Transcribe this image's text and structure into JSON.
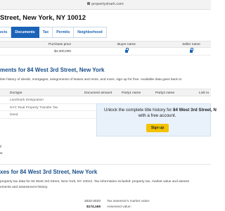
{
  "browser": {
    "url": "propertyshark.com"
  },
  "address": "Street, New York, NY 10012",
  "tabs": [
    {
      "label": "ects"
    },
    {
      "label": "Documents"
    },
    {
      "label": "Tax"
    },
    {
      "label": "Permits"
    },
    {
      "label": "Neighborhood"
    }
  ],
  "sale_table": {
    "headers": {
      "price": "Purchase price",
      "buyer": "Buyer name",
      "seller": "Seller name"
    },
    "row": {
      "price": "$4,300,000"
    }
  },
  "documents": {
    "heading": "ments for 84 West 3rd Street, New York",
    "description": "lete history of deeds, mortgages, assignments of leases and rents, and more, sign up for free. Available data goes back to",
    "columns": {
      "type": "Doctype",
      "amount": "Document amount",
      "party1": "Party1 name",
      "party2": "Party2 name",
      "link": "Link to"
    },
    "rows": [
      {
        "doctype": "Landmark Designation"
      },
      {
        "doctype": "NYC Real Property Transfer Tax"
      },
      {
        "doctype": "Deed"
      }
    ]
  },
  "unlock": {
    "text_prefix": "Unlock the complete title history for ",
    "text_bold": "84 West 3rd Street, N",
    "text_line2": "with a free account.",
    "button": "Sign up"
  },
  "fragments": {
    "a": "y",
    "b": "w"
  },
  "taxes": {
    "heading": "xes for 84 West 3rd Street, New York",
    "description_line1": "property tax data for 84 West 3rd Street, New York, NY 10012. Tax information included: property tax, market value and assess",
    "description_line2": "ements and assessment history.",
    "year": "2022-2023",
    "market_value_label": "Tax assessor's market value:",
    "amount": "$174,165",
    "assessed_value_label": "Assessed value:"
  }
}
